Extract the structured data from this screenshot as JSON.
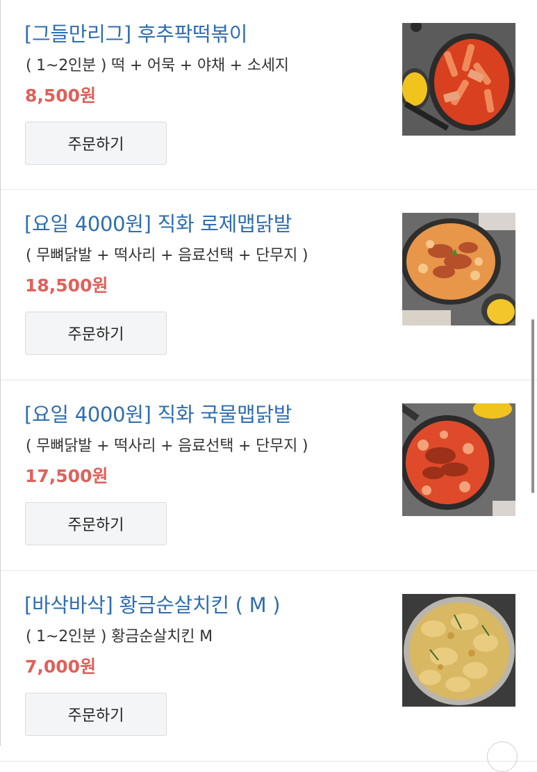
{
  "menu": {
    "items": [
      {
        "name": "[그들만리그] 후추팍떡볶이",
        "description": "( 1~2인분 ) 떡 + 어묵 + 야채 + 소세지",
        "price": "8,500원",
        "order_label": "주문하기",
        "photo_icon": "tteokbokki-photo"
      },
      {
        "name": "[요일 4000원] 직화 로제맵닭발",
        "description": "( 무뼈닭발 + 떡사리 + 음료선택 + 단무지 )",
        "price": "18,500원",
        "order_label": "주문하기",
        "photo_icon": "rose-chicken-feet-photo"
      },
      {
        "name": "[요일 4000원] 직화 국물맵닭발",
        "description": "( 무뼈닭발 + 떡사리 + 음료선택 + 단무지 )",
        "price": "17,500원",
        "order_label": "주문하기",
        "photo_icon": "spicy-soup-chicken-feet-photo"
      },
      {
        "name": "[바삭바삭] 황금순살치킨 ( M )",
        "description": "( 1~2인분 ) 황금순살치킨 M",
        "price": "7,000원",
        "order_label": "주문하기",
        "photo_icon": "boneless-chicken-photo"
      }
    ]
  },
  "colors": {
    "name": "#2f6db0",
    "price": "#e0605a",
    "button_bg": "#f4f5f7"
  }
}
